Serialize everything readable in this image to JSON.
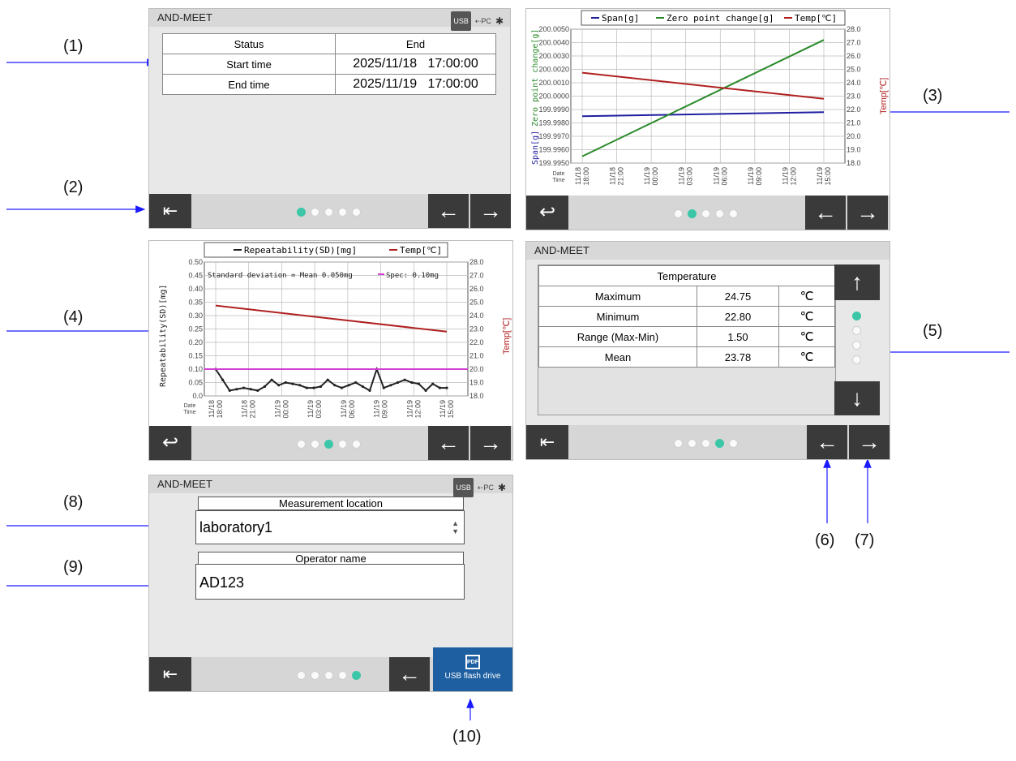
{
  "callouts": [
    "(1)",
    "(2)",
    "(3)",
    "(4)",
    "(5)",
    "(6)",
    "(7)",
    "(8)",
    "(9)",
    "(10)"
  ],
  "app_title": "AND-MEET",
  "status_icons": {
    "usb": "USB",
    "pc": "PC",
    "bluetooth": "bluetooth-icon"
  },
  "screen1": {
    "rows": [
      {
        "label": "Status",
        "value": "End"
      },
      {
        "label": "Start time",
        "value": "2025/11/18   17:00:00"
      },
      {
        "label": "End time",
        "value": "2025/11/19   17:00:00"
      }
    ]
  },
  "screen2": {
    "legend": [
      "Span[g]",
      "Zero point change[g]",
      "Temp[℃]"
    ],
    "ylabel_left_1": "Span[g]",
    "ylabel_left_2": "Zero point change[g]",
    "ylabel_right": "Temp[℃]",
    "date_label": "Date",
    "time_label": "Time"
  },
  "chart_data": [
    {
      "type": "line",
      "legend": [
        "Span[g]",
        "Zero point change[g]",
        "Temp[℃]"
      ],
      "x": [
        "11/18 18:00",
        "11/18 21:00",
        "11/19 00:00",
        "11/19 03:00",
        "11/19 06:00",
        "11/19 09:00",
        "11/19 12:00",
        "11/19 15:00"
      ],
      "y_left_ticks": [
        "200.0050",
        "200.0040",
        "200.0030",
        "200.0020",
        "200.0010",
        "200.0000",
        "199.9990",
        "199.9980",
        "199.9970",
        "199.9960",
        "199.9950"
      ],
      "y_right_ticks": [
        "28.0",
        "27.0",
        "26.0",
        "25.0",
        "24.0",
        "23.0",
        "22.0",
        "21.0",
        "20.0",
        "19.0",
        "18.0"
      ],
      "ylim_left": [
        199.995,
        200.005
      ],
      "ylim_right": [
        18.0,
        28.0
      ],
      "series": [
        {
          "name": "Span[g]",
          "color": "#1f1fa0",
          "axis": "left",
          "points": [
            [
              0,
              199.9985
            ],
            [
              1,
              199.9988
            ]
          ]
        },
        {
          "name": "Zero point change[g]",
          "color": "#2a8a2a",
          "axis": "left",
          "points": [
            [
              0,
              199.9955
            ],
            [
              1,
              200.0042
            ]
          ]
        },
        {
          "name": "Temp[℃]",
          "color": "#b02020",
          "axis": "right",
          "points": [
            [
              0,
              24.75
            ],
            [
              1,
              22.8
            ]
          ]
        }
      ],
      "grid": true
    },
    {
      "type": "line",
      "legend": [
        "Repeatability(SD)[mg]",
        "Temp[℃]"
      ],
      "x": [
        "11/18 18:00",
        "11/18 21:00",
        "11/19 00:00",
        "11/19 03:00",
        "11/19 06:00",
        "11/19 09:00",
        "11/19 12:00",
        "11/19 15:00"
      ],
      "y_left_ticks": [
        "0.50",
        "0.45",
        "0.40",
        "0.35",
        "0.30",
        "0.25",
        "0.20",
        "0.15",
        "0.10",
        "0.05",
        "0.0"
      ],
      "y_right_ticks": [
        "28.0",
        "27.0",
        "26.0",
        "25.0",
        "24.0",
        "23.0",
        "22.0",
        "21.0",
        "20.0",
        "19.0",
        "18.0"
      ],
      "ylim_left": [
        0,
        0.5
      ],
      "ylim_right": [
        18.0,
        28.0
      ],
      "series": [
        {
          "name": "Repeatability(SD)[mg]",
          "color": "#222222",
          "axis": "left",
          "values": [
            0.1,
            0.06,
            0.02,
            0.025,
            0.03,
            0.025,
            0.02,
            0.035,
            0.06,
            0.04,
            0.05,
            0.045,
            0.04,
            0.03,
            0.03,
            0.035,
            0.06,
            0.04,
            0.03,
            0.04,
            0.05,
            0.035,
            0.02,
            0.1,
            0.03,
            0.04,
            0.05,
            0.06,
            0.05,
            0.045,
            0.02,
            0.045,
            0.03,
            0.03
          ]
        },
        {
          "name": "Temp[℃]",
          "color": "#b02020",
          "axis": "right",
          "points": [
            [
              0,
              24.75
            ],
            [
              1,
              22.8
            ]
          ]
        },
        {
          "name": "Spec",
          "color": "#d23cd2",
          "axis": "left",
          "constant": 0.1
        }
      ],
      "annotations": {
        "sd_text": "Standard deviation = Mean  0.050mg",
        "spec_text": "Spec:    0.10mg"
      },
      "grid": true
    }
  ],
  "screen3": {
    "legend": [
      "Repeatability(SD)[mg]",
      "Temp[℃]"
    ],
    "ylabel_left": "Repeatability(SD)[mg]",
    "ylabel_right": "Temp[℃]",
    "sd_text": "Standard deviation = Mean  0.050mg",
    "spec_text": "Spec:    0.10mg",
    "date_label": "Date",
    "time_label": "Time"
  },
  "screen4": {
    "header": "Temperature",
    "rows": [
      {
        "label": "Maximum",
        "value": "24.75",
        "unit": "℃"
      },
      {
        "label": "Minimum",
        "value": "22.80",
        "unit": "℃"
      },
      {
        "label": "Range (Max-Min)",
        "value": "1.50",
        "unit": "℃"
      },
      {
        "label": "Mean",
        "value": "23.78",
        "unit": "℃"
      }
    ]
  },
  "screen5": {
    "location_title": "Measurement location",
    "location_value": "laboratory1",
    "operator_title": "Operator name",
    "operator_value": "AD123",
    "usb_button": "USB flash drive",
    "pdf_label": "PDF"
  },
  "colors": {
    "accent": "#3cc6a8",
    "nav": "#3a3a3a",
    "usb_button": "#1d5fa0",
    "callout_arrow": "#1a1aff"
  }
}
